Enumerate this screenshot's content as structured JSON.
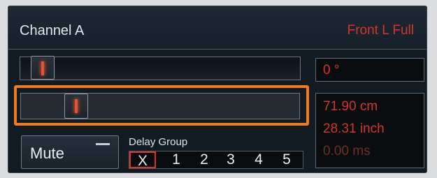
{
  "channel": {
    "name": "Channel A",
    "route": "Front L Full"
  },
  "phase": {
    "value": 0.04,
    "readout": "0 °"
  },
  "delay": {
    "value": 0.17,
    "distance_cm": "71.90 cm",
    "distance_inch": "28.31 inch",
    "time_ms": "0.00 ms"
  },
  "mute": {
    "label": "Mute"
  },
  "delay_group": {
    "label": "Delay Group",
    "options": [
      "X",
      "1",
      "2",
      "3",
      "4",
      "5"
    ],
    "selected": "X"
  },
  "colors": {
    "accent": "#d8342a",
    "highlight": "#f07a1d",
    "dim_value": "#6f2e23"
  }
}
